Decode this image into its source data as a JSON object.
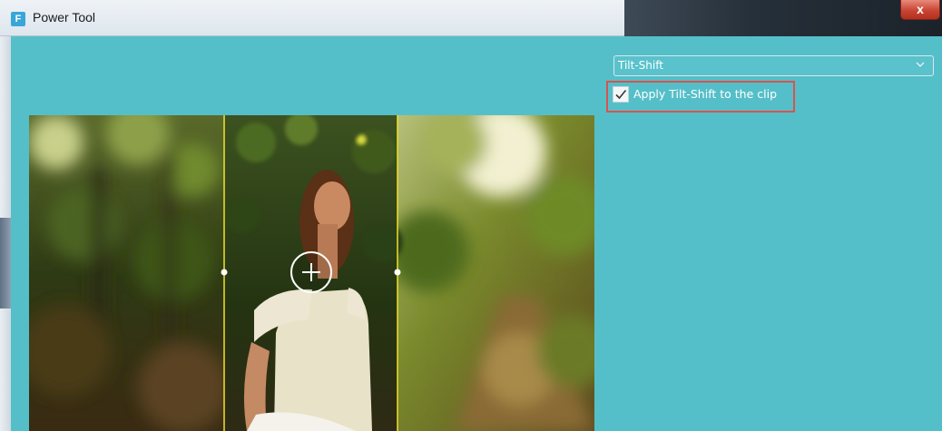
{
  "window": {
    "title": "Power Tool",
    "app_icon_letter": "F",
    "close_symbol": "x"
  },
  "effect_select": {
    "selected": "Tilt-Shift"
  },
  "apply_checkbox": {
    "label": "Apply Tilt-Shift to the clip",
    "checked": true
  },
  "preview": {
    "focus_handle_symbol": "+"
  },
  "colors": {
    "panel_bg": "#55bfc9",
    "guide_line": "#f2e02a",
    "highlight_box": "#d9534f"
  }
}
